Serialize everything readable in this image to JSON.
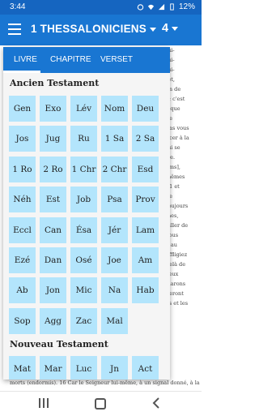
{
  "status": {
    "time": "3:44",
    "battery": "12%"
  },
  "header": {
    "book": "1 THESSALONICIENS",
    "chapter": "4"
  },
  "tabs": [
    "LIVRE",
    "CHAPITRE",
    "VERSET"
  ],
  "sections": {
    "ancien": "Ancien Testament",
    "nouveau": "Nouveau Testament"
  },
  "ot_books": [
    "Gen",
    "Exo",
    "Lév",
    "Nom",
    "Deu",
    "Jos",
    "Jug",
    "Ru",
    "1 Sa",
    "2 Sa",
    "1 Ro",
    "2 Ro",
    "1 Chr",
    "2 Chr",
    "Esd",
    "Néh",
    "Est",
    "Job",
    "Psa",
    "Prov",
    "Eccl",
    "Can",
    "Ésa",
    "Jér",
    "Lam",
    "Ezé",
    "Dan",
    "Osé",
    "Joe",
    "Am",
    "Ab",
    "Jon",
    "Mic",
    "Na",
    "Hab",
    "Sop",
    "Agg",
    "Zac",
    "Mal"
  ],
  "nt_books": [
    "Mat",
    "Mar",
    "Luc",
    "Jn",
    "Act"
  ],
  "bg_lines": [
    "",
    "",
    "",
    "",
    "lui-",
    "lui-",
    "lui-",
    "",
    "fet,",
    "on de",
    "",
    "e; c'est",
    "s que",
    "de",
    "",
    "pas vous",
    "",
    "",
    "ncer à la",
    "lui se",
    "ire.",
    "",
    "",
    "ams],",
    "mêmes",
    "11 et",
    "ne",
    "toujours",
    "mes,",
    "ailler de",
    "vous",
    "",
    "",
    "",
    "",
    "",
    "",
    "",
    "",
    "",
    "",
    "",
    "e au",
    "affligiez",
    "delà de",
    "",
    "ceux",
    "clarons",
    "neront",
    "es et les"
  ],
  "bottom_line": "morts (endormis). 16 Car le Seigneur lui-même, à un signal donné, à la"
}
